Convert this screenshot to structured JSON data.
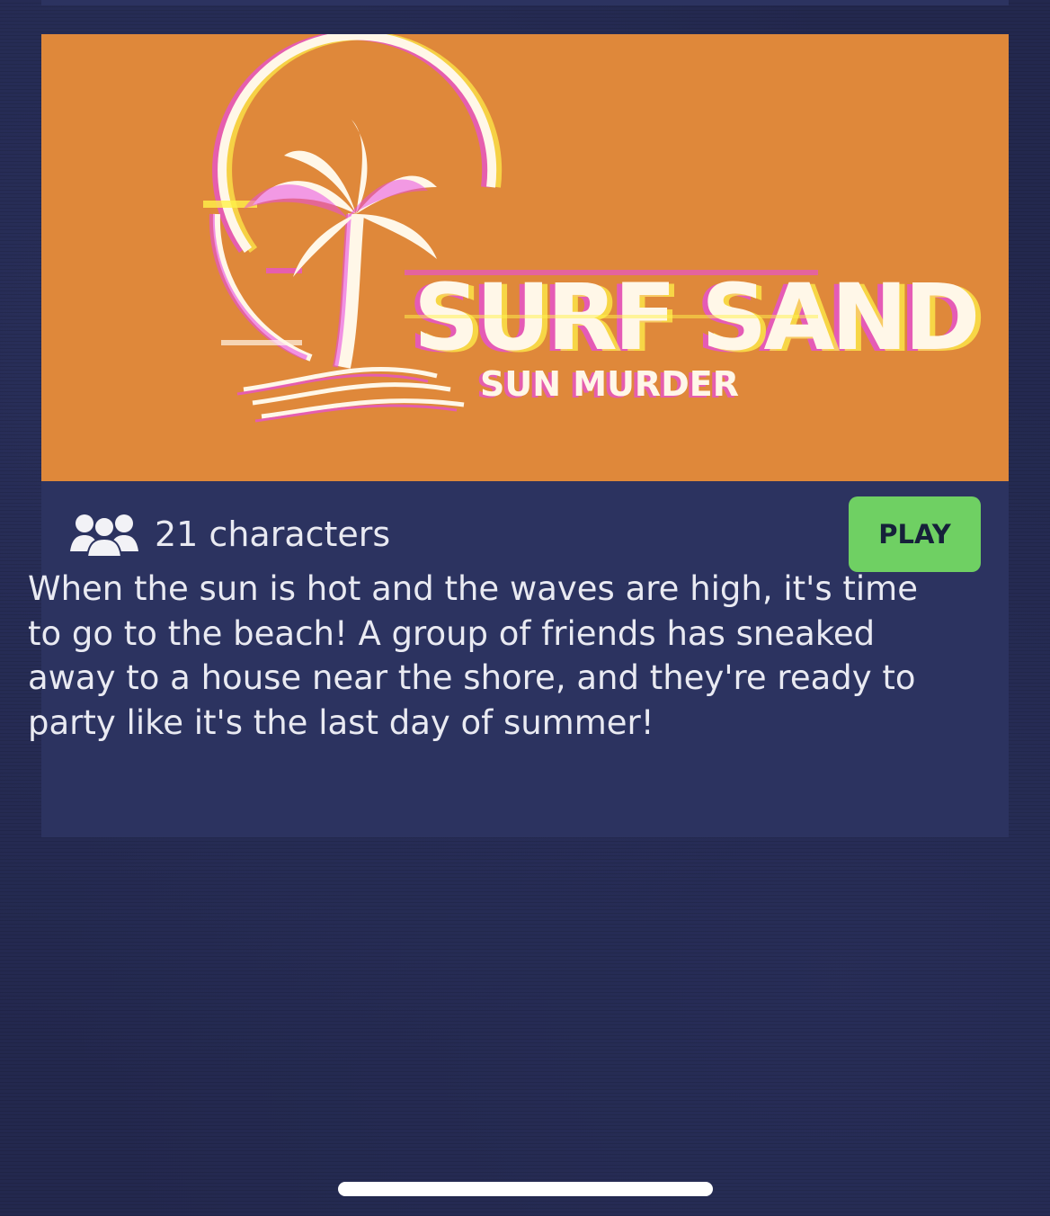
{
  "game": {
    "logo_title": "SURF SAND",
    "logo_subtitle": "SUN MURDER",
    "characters_label": "21 characters",
    "play_label": "PLAY",
    "description": "When the sun is hot and the waves are high, it's time to go to the beach! A group of friends has sneaked away to a house near the shore, and they're ready to party like it's the last day of summer!"
  },
  "icons": {
    "characters": "people-group-icon",
    "logo": "palm-tree-sun-icon"
  },
  "colors": {
    "background": "#23284e",
    "card": "#2c3360",
    "banner": "#df883a",
    "play_button": "#6fd063",
    "text": "#e9eaf2"
  }
}
